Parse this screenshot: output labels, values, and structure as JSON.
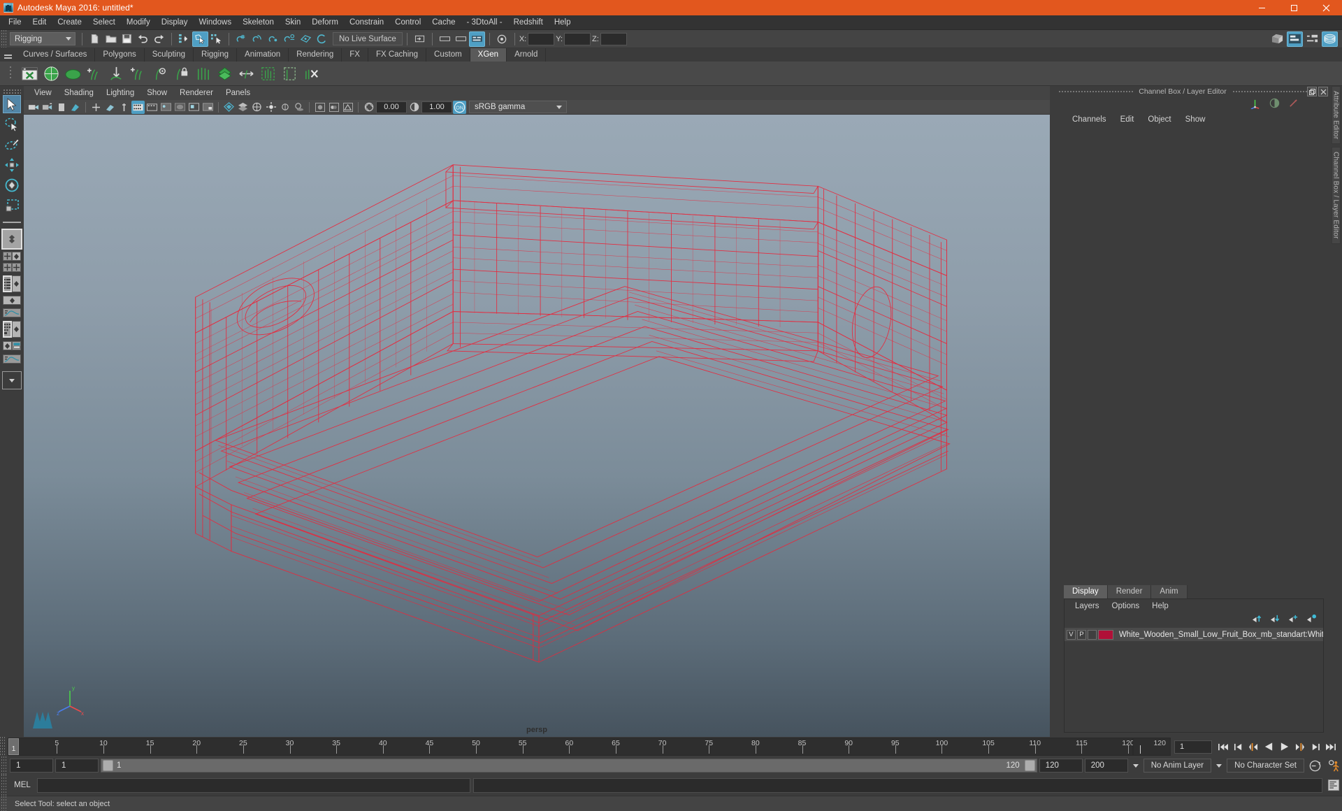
{
  "window": {
    "title": "Autodesk Maya 2016: untitled*",
    "app_icon": "maya-app-icon",
    "controls": {
      "minimize": "minimize-icon",
      "maximize": "maximize-icon",
      "close": "close-icon"
    }
  },
  "menubar": {
    "items": [
      "File",
      "Edit",
      "Create",
      "Select",
      "Modify",
      "Display",
      "Windows",
      "Skeleton",
      "Skin",
      "Deform",
      "Constrain",
      "Control",
      "Cache",
      "- 3DtoAll -",
      "Redshift",
      "Help"
    ]
  },
  "statusline": {
    "menu_set": "Rigging",
    "live_surface": "No Live Surface",
    "coords": {
      "x_label": "X:",
      "y_label": "Y:",
      "z_label": "Z:",
      "x_value": "",
      "y_value": "",
      "z_value": ""
    },
    "icons_left": [
      "new-scene-icon",
      "open-scene-icon",
      "save-scene-icon",
      "undo-icon",
      "redo-icon"
    ],
    "selection_modes": [
      "select-by-hierarchy-icon",
      "select-by-object-icon",
      "select-by-component-icon"
    ],
    "snap_icons": [
      "snap-to-grid-icon",
      "snap-to-curve-icon",
      "snap-to-point-icon",
      "snap-to-projected-center-icon",
      "snap-to-view-plane-icon",
      "make-live-icon"
    ],
    "icons_right": [
      "render-view-icon",
      "attribute-editor-toggle-icon",
      "tool-settings-toggle-icon",
      "channel-box-toggle-icon"
    ]
  },
  "shelf": {
    "tabs": [
      "Curves / Surfaces",
      "Polygons",
      "Sculpting",
      "Rigging",
      "Animation",
      "Rendering",
      "FX",
      "FX Caching",
      "Custom",
      "XGen",
      "Arnold"
    ],
    "active_tab": "XGen",
    "buttons": [
      "xgen-editor-icon",
      "xgen-sphere-icon",
      "xgen-dome-icon",
      "xgen-add-guide-icon",
      "xgen-guide-down-icon",
      "xgen-add-clump-icon",
      "xgen-eye-guide-icon",
      "xgen-lock-guide-icon",
      "xgen-comb-icon",
      "xgen-density-icon",
      "xgen-width-icon",
      "xgen-region-icon",
      "xgen-mask-icon",
      "xgen-delete-icon"
    ]
  },
  "toolbox": {
    "tools": [
      "select-tool-icon",
      "lasso-select-tool-icon",
      "paint-select-tool-icon",
      "move-tool-icon",
      "rotate-tool-icon",
      "scale-tool-icon"
    ],
    "active_tool": "select-tool-icon",
    "layouts": [
      "single-perspective-layout-icon",
      "four-view-layout-icon",
      "two-pane-stacked-layout-icon",
      "outliner-persp-layout-icon",
      "persp-graph-layout-icon",
      "hypershade-persp-layout-icon",
      "persp-graph-outliner-layout-icon",
      "more-layouts-icon"
    ]
  },
  "viewport": {
    "menus": [
      "View",
      "Shading",
      "Lighting",
      "Show",
      "Renderer",
      "Panels"
    ],
    "toolbar": {
      "exposure_value": "0.00",
      "gamma_value": "1.00",
      "color_management": "sRGB gamma",
      "cm_toggle": "ON",
      "icons": [
        "select-camera-icon",
        "lock-camera-icon",
        "bookmark-icon",
        "image-plane-icon",
        "two-d-pan-zoom-icon",
        "grid-toggle-icon",
        "film-gate-icon",
        "resolution-gate-icon",
        "gate-mask-icon",
        "exposure-icon",
        "gamma-icon",
        "wireframe-shading-icon",
        "smooth-shade-all-icon",
        "flat-shade-icon",
        "wireframe-on-shaded-icon",
        "texture-toggle-icon",
        "lights-toggle-icon",
        "shadows-toggle-icon",
        "screen-space-ao-icon",
        "motion-blur-icon",
        "multisample-icon",
        "isolate-select-icon",
        "xray-icon",
        "xray-joints-icon"
      ]
    },
    "camera_label": "persp",
    "gizmo": {
      "x_label": "x",
      "y_label": "y",
      "z_label": "z"
    },
    "model": {
      "name": "White_Wooden_Small_Low_Fruit_Box",
      "display": "wireframe",
      "wire_color": "#e8283c"
    },
    "background": {
      "top": "#9aa9b6",
      "bottom": "#46535e"
    }
  },
  "right_panel": {
    "title": "Channel Box / Layer Editor",
    "window_buttons": [
      "undock-icon",
      "close-icon"
    ],
    "channel_box": {
      "menus": [
        "Channels",
        "Edit",
        "Object",
        "Show"
      ],
      "tool_icons": [
        "manipulator-icon",
        "toggle-channel-icon",
        "speed-icon"
      ],
      "rows": []
    },
    "layer_editor": {
      "tabs": [
        "Display",
        "Render",
        "Anim"
      ],
      "active_tab": "Display",
      "menus": [
        "Layers",
        "Options",
        "Help"
      ],
      "icon_buttons": [
        "move-layer-up-icon",
        "move-layer-down-icon",
        "create-empty-layer-icon",
        "create-layer-from-selected-icon"
      ],
      "layers": [
        {
          "visibility": "V",
          "playback": "P",
          "shading": "",
          "color": "#b01038",
          "name": "White_Wooden_Small_Low_Fruit_Box_mb_standart:Whit"
        }
      ]
    },
    "side_tabs": [
      "Attribute Editor",
      "Channel Box / Layer Editor"
    ]
  },
  "time_slider": {
    "start_tick": 1,
    "end_tick": 120,
    "tick_labels": [
      5,
      10,
      15,
      20,
      25,
      30,
      35,
      40,
      45,
      50,
      55,
      60,
      65,
      70,
      75,
      80,
      85,
      90,
      95,
      100,
      105,
      110,
      115,
      120
    ],
    "current_frame": "1",
    "current_frame_field": "1",
    "end_label": "120",
    "playback_buttons": [
      "go-to-start-icon",
      "step-back-keyframe-icon",
      "step-back-frame-icon",
      "play-backwards-icon",
      "play-forwards-icon",
      "step-forward-frame-icon",
      "step-forward-keyframe-icon",
      "go-to-end-icon"
    ]
  },
  "range_slider": {
    "range_start": "1",
    "anim_start": "1",
    "slider_left_label": "1",
    "slider_right_label": "120",
    "anim_end": "120",
    "range_end": "200",
    "anim_layer": "No Anim Layer",
    "character_set": "No Character Set",
    "auto_key_icon": "auto-keyframe-icon",
    "anim_prefs_icon": "animation-preferences-icon"
  },
  "command_line": {
    "language_label": "MEL",
    "input_value": "",
    "output_value": "",
    "script_editor_icon": "script-editor-icon"
  },
  "status_bar": {
    "message": "Select Tool: select an object"
  },
  "colors": {
    "title_bar": "#e2571e",
    "accent_blue": "#5285a6",
    "wire_red": "#e8283c",
    "panel_bg": "#3c3c3c",
    "toolbar_bg": "#444444"
  }
}
